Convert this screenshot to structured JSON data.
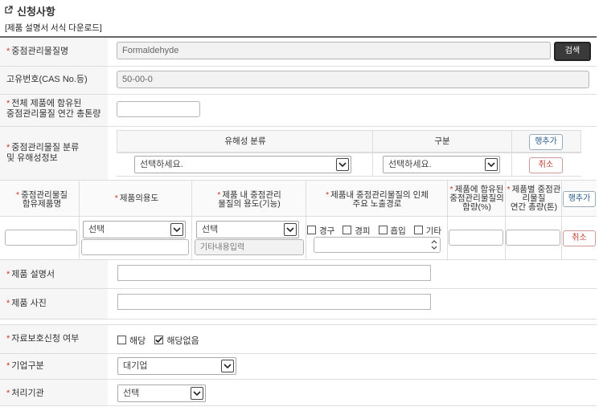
{
  "section": {
    "title": "신청사항",
    "download_link": "[제품 설명서 서식 다운로드]"
  },
  "substance": {
    "label": "중점관리물질명",
    "value": "Formaldehyde",
    "search_label": "검색"
  },
  "cas": {
    "label": "고유번호(CAS No.등)",
    "value": "50-00-0"
  },
  "total": {
    "label_line1": "전체 제품에 함유된",
    "label_line2": "중점관리물질 연간 총톤량",
    "value": ""
  },
  "hazard": {
    "label_line1": "중점관리물질 분류",
    "label_line2": "및 유해성정보",
    "col_class": "유해성 분류",
    "col_type": "구분",
    "add_row": "행추가",
    "class_select": "선택하세요.",
    "type_select": "선택하세요.",
    "cancel": "취소"
  },
  "product_table": {
    "col1_line1": "중점관리물질",
    "col1_line2": "함유제품명",
    "col2": "제품의용도",
    "col3_line1": "제품 내 중점관리",
    "col3_line2": "물질의 용도(기능)",
    "col4_line1": "제품내 중점관리물질의 인체",
    "col4_line2": "주요 노출경로",
    "col5_line1": "제품에 함유된",
    "col5_line2": "중점관리물질의",
    "col5_line3": "함량(%)",
    "col6_line1": "제품별 중점관",
    "col6_line2": "리물질",
    "col6_line3": "연간 총량(톤)",
    "add_row": "행추가",
    "use_select": "선택",
    "func_select": "선택",
    "other_placeholder": "기타내용입력",
    "routes": [
      "경구",
      "경피",
      "흡입",
      "기타"
    ],
    "cancel": "취소"
  },
  "description": {
    "label": "제품 설명서",
    "value": ""
  },
  "photo": {
    "label": "제품 사진",
    "value": ""
  },
  "protection": {
    "label": "자료보호신청 여부",
    "opt_yes": "해당",
    "opt_no": "해당없음",
    "opt_yes_checked": false,
    "opt_no_checked": true
  },
  "company": {
    "label": "기업구분",
    "value": "대기업"
  },
  "agency": {
    "label": "처리기관",
    "value": "선택"
  }
}
